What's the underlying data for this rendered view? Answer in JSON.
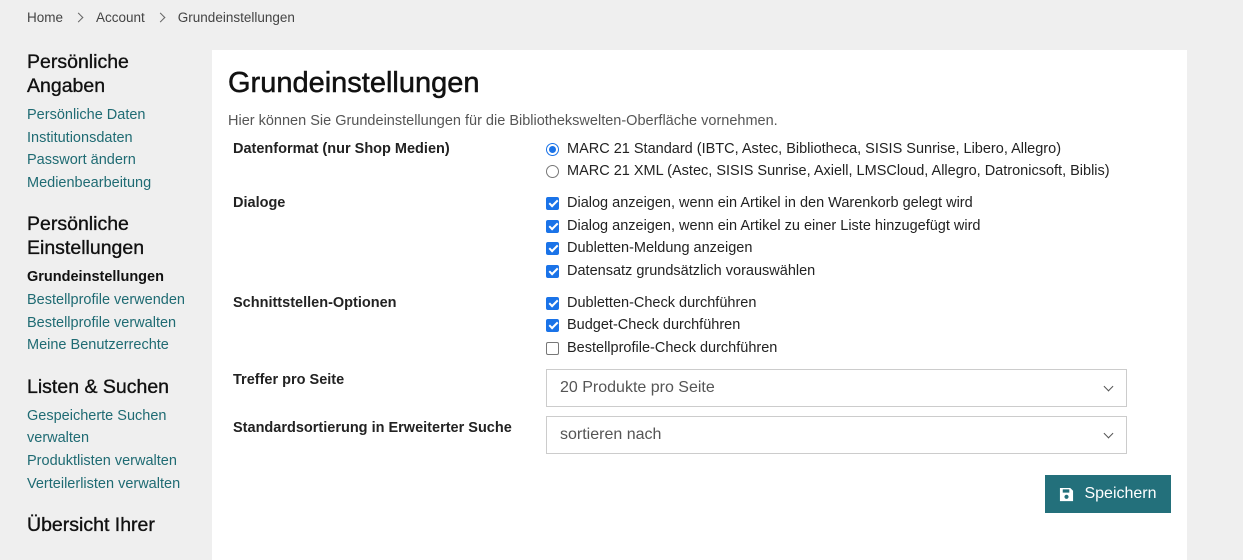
{
  "breadcrumb": [
    "Home",
    "Account",
    "Grundeinstellungen"
  ],
  "sidebar": {
    "sections": [
      {
        "title_lines": [
          "Persönliche",
          "Angaben"
        ],
        "items": [
          "Persönliche Daten",
          "Institutionsdaten",
          "Passwort ändern",
          "Medienbearbeitung"
        ]
      },
      {
        "title_lines": [
          "Persönliche",
          "Einstellungen"
        ],
        "items": [
          "Grundeinstellungen",
          "Bestellprofile verwenden",
          "Bestellprofile verwalten",
          "Meine Benutzerrechte"
        ],
        "active": "Grundeinstellungen"
      },
      {
        "title_lines": [
          "Listen & Suchen"
        ],
        "items": [
          "Gespeicherte Suchen",
          "verwalten",
          "Produktlisten verwalten",
          "Verteilerlisten verwalten"
        ]
      },
      {
        "title_lines": [
          "Übersicht Ihrer"
        ],
        "items": []
      }
    ]
  },
  "main": {
    "title": "Grundeinstellungen",
    "subtitle": "Hier können Sie Grundeinstellungen für die Bibliothekswelten-Oberfläche vornehmen.",
    "datenformat": {
      "label": "Datenformat (nur Shop Medien)",
      "options": [
        {
          "text": "MARC 21 Standard (IBTC, Astec, Bibliotheca, SISIS Sunrise, Libero, Allegro)",
          "checked": true
        },
        {
          "text": "MARC 21 XML (Astec, SISIS Sunrise, Axiell, LMSCloud, Allegro, Datronicsoft, Biblis)",
          "checked": false
        }
      ]
    },
    "dialoge": {
      "label": "Dialoge",
      "options": [
        {
          "text": "Dialog anzeigen, wenn ein Artikel in den Warenkorb gelegt wird",
          "checked": true
        },
        {
          "text": "Dialog anzeigen, wenn ein Artikel zu einer Liste hinzugefügt wird",
          "checked": true
        },
        {
          "text": "Dubletten-Meldung anzeigen",
          "checked": true
        },
        {
          "text": "Datensatz grundsätzlich vorauswählen",
          "checked": true
        }
      ]
    },
    "schnittstellen": {
      "label": "Schnittstellen-Optionen",
      "options": [
        {
          "text": "Dubletten-Check durchführen",
          "checked": true
        },
        {
          "text": "Budget-Check durchführen",
          "checked": true
        },
        {
          "text": "Bestellprofile-Check durchführen",
          "checked": false
        }
      ]
    },
    "treffer": {
      "label": "Treffer pro Seite",
      "value": "20 Produkte pro Seite"
    },
    "sortierung": {
      "label": "Standardsortierung in Erweiterter Suche",
      "value": "sortieren nach"
    },
    "save_label": "Speichern"
  }
}
